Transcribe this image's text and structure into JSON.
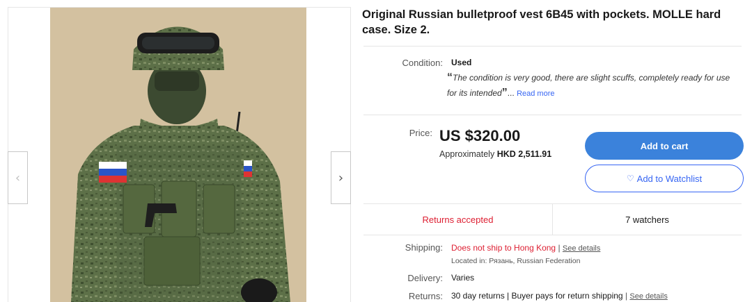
{
  "listing": {
    "title": "Original Russian bulletproof vest 6B45 with pockets. MOLLE hard case. Size 2."
  },
  "gallery": {
    "prev_icon": "chevron-left-icon",
    "next_icon": "chevron-right-icon",
    "prev_glyph": "‹",
    "next_glyph": "›"
  },
  "condition": {
    "label": "Condition:",
    "value": "Used",
    "quote_open": "“",
    "quote_text": "The condition is very good, there are slight scuffs, completely ready for use for its intended",
    "quote_close": "”",
    "ellipsis": "...",
    "read_more": "Read more"
  },
  "price": {
    "label": "Price:",
    "value": "US $320.00",
    "approx_prefix": "Approximately",
    "approx_value": "HKD 2,511.91"
  },
  "buttons": {
    "add_to_cart": "Add to cart",
    "watchlist_icon": "♡",
    "add_to_watchlist": "Add to Watchlist"
  },
  "stats": {
    "returns": "Returns accepted",
    "watchers": "7 watchers"
  },
  "shipping": {
    "label": "Shipping:",
    "value": "Does not ship to Hong Kong",
    "separator": " | ",
    "see_details": "See details",
    "located": "Located in: Рязань, Russian Federation"
  },
  "delivery": {
    "label": "Delivery:",
    "value": "Varies"
  },
  "returns": {
    "label": "Returns:",
    "value": "30 day returns | Buyer pays for return shipping",
    "separator": " | ",
    "see_details": "See details"
  },
  "colors": {
    "accent": "#3665f3",
    "cart_button": "#3b82db",
    "alert": "#dd1e31"
  }
}
